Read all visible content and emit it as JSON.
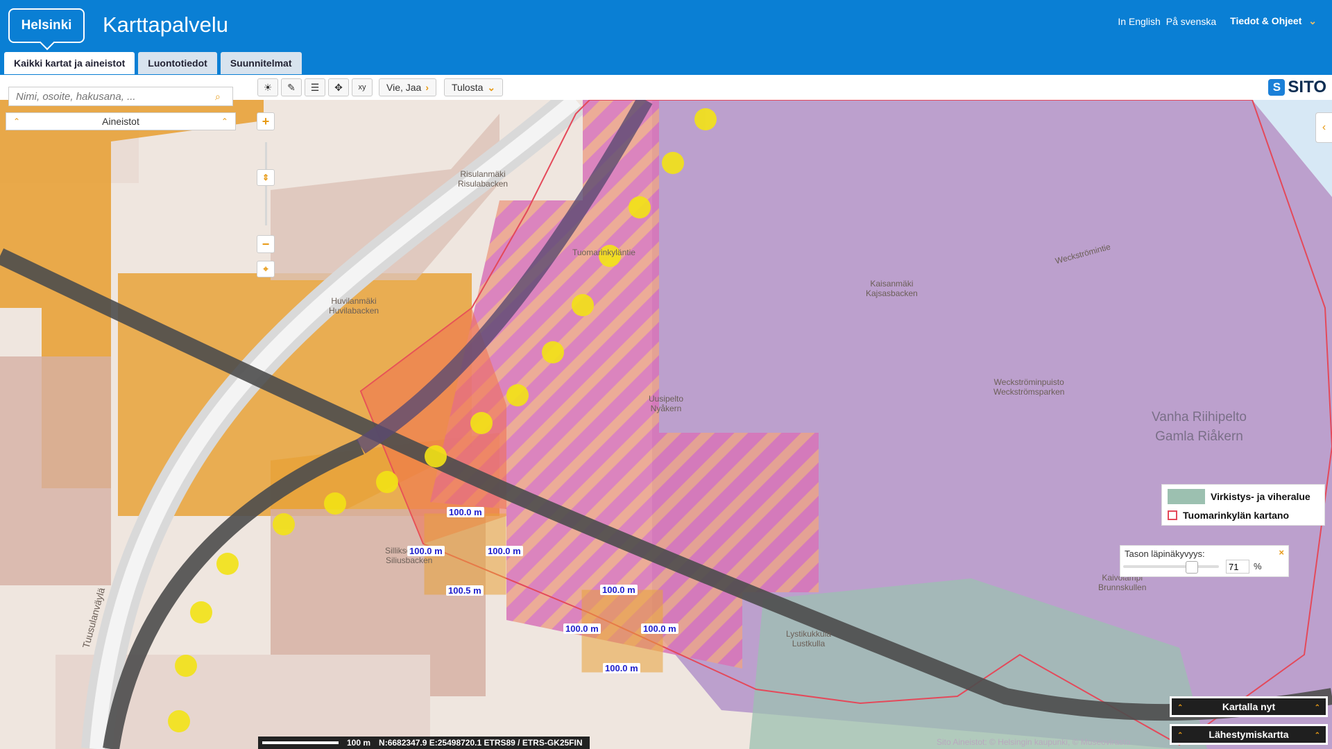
{
  "header": {
    "logo_text": "Helsinki",
    "app_title": "Karttapalvelu",
    "lang_en": "In English",
    "lang_sv": "På svenska",
    "info_menu": "Tiedot & Ohjeet",
    "info_chevron": "⌄"
  },
  "tabs": [
    {
      "label": "Kaikki kartat ja aineistot",
      "active": true
    },
    {
      "label": "Luontotiedot",
      "active": false
    },
    {
      "label": "Suunnitelmat",
      "active": false
    }
  ],
  "toolbar": {
    "icons": [
      "☀",
      "✎",
      "☰",
      "✥",
      "xy"
    ],
    "share_label": "Vie, Jaa",
    "share_chevron": "›",
    "print_label": "Tulosta",
    "print_chevron": "⌄"
  },
  "brand": {
    "name": "SITO",
    "mark": "S"
  },
  "search": {
    "placeholder": "Nimi, osoite, hakusana, ...",
    "icon": "⌕"
  },
  "layers": {
    "label": "Aineistot",
    "chevron": "⌃"
  },
  "zoom": {
    "in": "+",
    "out": "−",
    "handle": "⇕",
    "locate": "⌖"
  },
  "side_toggle": "‹",
  "legend": {
    "items": [
      {
        "label": "Virkistys- ja viheralue",
        "color": "#9cc0b0"
      },
      {
        "label": "Tuomarinkylän kartano",
        "color": "#e4495a"
      }
    ]
  },
  "opacity": {
    "label": "Tason läpinäkyvyys:",
    "value": "71",
    "level_percent": 71,
    "unit": "%",
    "close": "×"
  },
  "panels": {
    "map_now": "Kartalla nyt",
    "overview": "Lähestymiskartta",
    "chevron": "⌃"
  },
  "statusbar": {
    "scale": "100 m",
    "coords": "N:6682347.9 E:25498720.1 ETRS89 / ETRS-GK25FIN"
  },
  "attribution": "Sito Aineistot: © Helsingin kaupunki, © Museovirasto",
  "measurements": [
    "100.0 m",
    "100.0 m",
    "100.0 m",
    "100.5 m",
    "100.0 m",
    "100.0 m",
    "100.0 m",
    "100.0 m"
  ],
  "place_names": {
    "risulanmaki": "Risulanmäki",
    "risulabacken": "Risulabacken",
    "huvilanmaki": "Huvilanmäki",
    "huvilabacken": "Huvilabacken",
    "kaisanmaki": "Kaisanmäki",
    "kajsasbacken": "Kajsasbacken",
    "uusipelto": "Uusipelto",
    "nyakern": "Nyåkern",
    "weckstrominpuisto": "Weckströminpuisto",
    "weckstromsparken": "Weckströmsparken",
    "silliksenmaki": "Silliksenmäki",
    "siliusbacken": "Siliusbacken",
    "lystikukkula": "Lystikukkula",
    "lustkulla": "Lustkulla",
    "vanha_riihipelto": "Vanha Riihipelto",
    "gamla_riakern": "Gamla Riåkern",
    "tuusulanvayla": "Tuusulanväylä",
    "tuomarinkylantie": "Tuomarinkyläntie",
    "weckstromintie": "Weckströmintie",
    "kaivolampi": "Kaivolampi",
    "brunnskullen": "Brunnskullen"
  },
  "colors": {
    "header_bg": "#0a7fd4",
    "accent": "#e79a15",
    "purple_zone": "#b89ccb",
    "orange_zone": "#e8a23a",
    "pink_zone": "#e88fb0",
    "railway": "#4d4d4d",
    "yellow_marker": "#f3e316"
  }
}
